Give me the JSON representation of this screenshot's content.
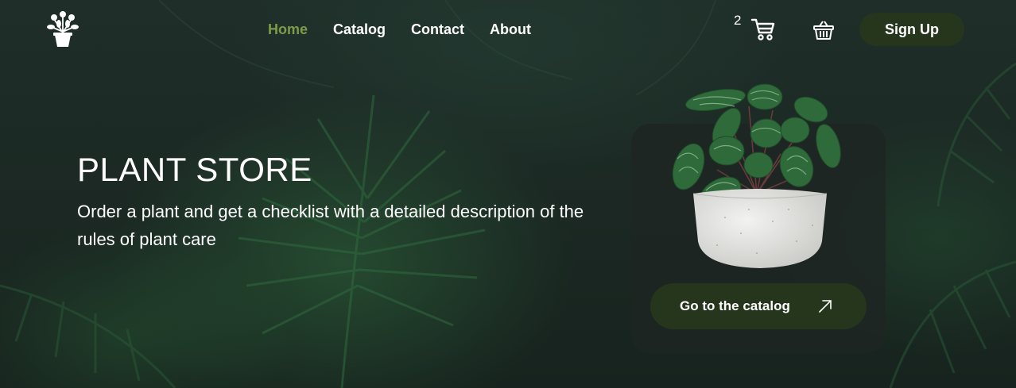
{
  "nav": {
    "items": [
      {
        "label": "Home",
        "active": true
      },
      {
        "label": "Catalog",
        "active": false
      },
      {
        "label": "Contact",
        "active": false
      },
      {
        "label": "About",
        "active": false
      }
    ]
  },
  "header": {
    "logo_icon": "flower-pot-logo-icon",
    "cart_count": "2",
    "cart_icon": "shopping-cart-icon",
    "basket_icon": "basket-icon",
    "signup_label": "Sign Up"
  },
  "hero": {
    "title": "PLANT STORE",
    "subtitle": "Order a plant and get a checklist with a detailed description of the rules of plant care"
  },
  "card": {
    "image_icon": "potted-plant-image",
    "button_label": "Go to the catalog",
    "button_icon": "arrow-up-right-icon"
  },
  "colors": {
    "accent_active_nav": "#7e9b4a",
    "button_bg": "#26361d",
    "text": "#ffffff",
    "background": "#1c2a25"
  }
}
